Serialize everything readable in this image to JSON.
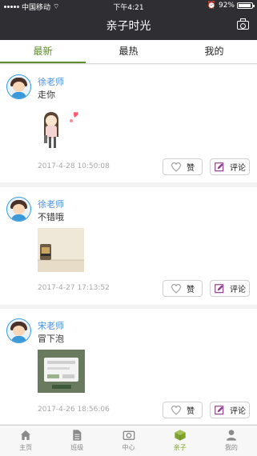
{
  "status": {
    "carrier": "中国移动",
    "time": "下午4:21",
    "battery": "92%"
  },
  "header": {
    "title": "亲子时光"
  },
  "tabs": [
    {
      "label": "最新"
    },
    {
      "label": "最热"
    },
    {
      "label": "我的"
    }
  ],
  "posts": [
    {
      "name": "徐老师",
      "text": "走你",
      "time": "2017-4-28 10:50:08",
      "like_label": "赞",
      "comment_label": "评论"
    },
    {
      "name": "徐老师",
      "text": "不错哦",
      "time": "2017-4-27 17:13:52",
      "like_label": "赞",
      "comment_label": "评论"
    },
    {
      "name": "宋老师",
      "text": "冒下泡",
      "time": "2017-4-26 18:56:06",
      "like_label": "赞",
      "comment_label": "评论"
    }
  ],
  "bottom_nav": [
    {
      "label": "主页"
    },
    {
      "label": "班级"
    },
    {
      "label": "中心"
    },
    {
      "label": "亲子"
    },
    {
      "label": "我的"
    }
  ],
  "colors": {
    "accent": "#5e8c2f",
    "header": "#2f2f33",
    "name": "#4a90e2"
  }
}
